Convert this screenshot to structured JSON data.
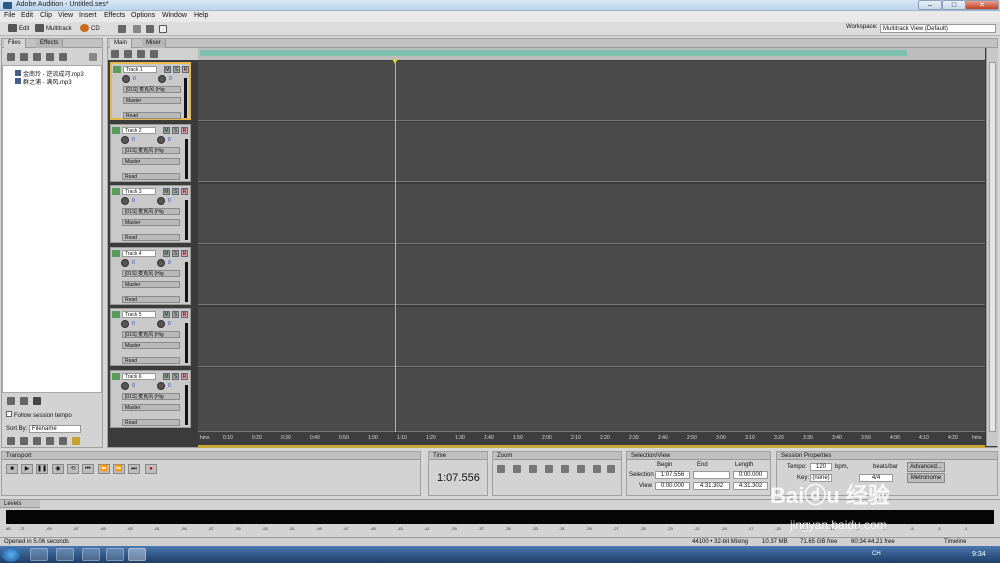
{
  "window": {
    "title": "Adobe Audition - Untitled.ses*",
    "min": "–",
    "max": "□",
    "close": "✕"
  },
  "menu": [
    "File",
    "Edit",
    "Clip",
    "View",
    "Insert",
    "Effects",
    "Options",
    "Window",
    "Help"
  ],
  "toolbar": {
    "edit": "Edit",
    "multitrack": "Multitrack",
    "cd": "CD",
    "workspace_label": "Workspace:",
    "workspace_value": "Multitrack View (Default)"
  },
  "files_panel": {
    "tabs": [
      "Files",
      "Effects"
    ],
    "files": [
      "金南玲 - 逆流成河.mp3",
      "群之浦 - 满风.mp3"
    ],
    "follow_tempo": "Follow session tempo",
    "sort_by_label": "Sort By:",
    "sort_by_value": "Filename"
  },
  "main_tabs": [
    "Main",
    "Mixer"
  ],
  "tracks": [
    {
      "name": "Track 1",
      "vol": "0",
      "pan": "0",
      "input": "[01S] 麦克风 (Hig",
      "output": "Master",
      "mode": "Read"
    },
    {
      "name": "Track 2",
      "vol": "0",
      "pan": "0",
      "input": "[01S] 麦克风 (Hig",
      "output": "Master",
      "mode": "Read"
    },
    {
      "name": "Track 3",
      "vol": "0",
      "pan": "0",
      "input": "[01S] 麦克风 (Hig",
      "output": "Master",
      "mode": "Read"
    },
    {
      "name": "Track 4",
      "vol": "0",
      "pan": "0",
      "input": "[01S] 麦克风 (Hig",
      "output": "Master",
      "mode": "Read"
    },
    {
      "name": "Track 5",
      "vol": "0",
      "pan": "0",
      "input": "[01S] 麦克风 (Hig",
      "output": "Master",
      "mode": "Read"
    },
    {
      "name": "Track 6",
      "vol": "0",
      "pan": "0",
      "input": "[01S] 麦克风 (Hig",
      "output": "Master",
      "mode": "Read"
    }
  ],
  "msr": [
    "M",
    "S",
    "R"
  ],
  "ruler": [
    "hms",
    "0:10",
    "0:20",
    "0:30",
    "0:40",
    "0:50",
    "1:00",
    "1:10",
    "1:20",
    "1:30",
    "1:40",
    "1:50",
    "2:00",
    "2:10",
    "2:20",
    "2:30",
    "2:40",
    "2:50",
    "3:00",
    "3:10",
    "3:20",
    "3:30",
    "3:40",
    "3:50",
    "4:00",
    "4:10",
    "4:20",
    "hms"
  ],
  "transport": {
    "title": "Transport"
  },
  "time": {
    "title": "Time",
    "value": "1:07.556"
  },
  "zoom": {
    "title": "Zoom"
  },
  "selection": {
    "title": "Selection/View",
    "begin_h": "Begin",
    "end_h": "End",
    "length_h": "Length",
    "sel_label": "Selection",
    "view_label": "View",
    "sel_begin": "1:07.556",
    "sel_end": "",
    "sel_length": "0:00.000",
    "view_begin": "0:00.000",
    "view_end": "4:31.302",
    "view_length": "4:31.302"
  },
  "session": {
    "title": "Session Properties",
    "tempo_label": "Tempo:",
    "tempo": "120",
    "bpm": "bpm,",
    "beats": "beats/bar",
    "advanced": "Advanced...",
    "key_label": "Key:",
    "key": "(none)",
    "time_sig": "4/4",
    "metronome": "Metronome"
  },
  "levels": {
    "title": "Levels",
    "scale": [
      "dB",
      "-71",
      "-69",
      "-67",
      "-65",
      "-63",
      "-61",
      "-59",
      "-57",
      "-55",
      "-53",
      "-51",
      "-49",
      "-47",
      "-45",
      "-43",
      "-41",
      "-39",
      "-37",
      "-35",
      "-33",
      "-31",
      "-29",
      "-27",
      "-25",
      "-23",
      "-21",
      "-19",
      "-17",
      "-15",
      "-13",
      "-11",
      "-9",
      "-7",
      "-5",
      "-3",
      "-1"
    ]
  },
  "status": {
    "left": "Opened in 5.06 seconds",
    "format": "44100 • 32-bit Mixing",
    "mem": "10.37 MB",
    "disk": "71.65 GB free",
    "time_free": "60:34:44.21 free",
    "view": "Timeline"
  },
  "taskbar": {
    "clock": "9:34",
    "lang": "CH"
  },
  "watermark": {
    "site": "jingyan.baidu.com"
  }
}
